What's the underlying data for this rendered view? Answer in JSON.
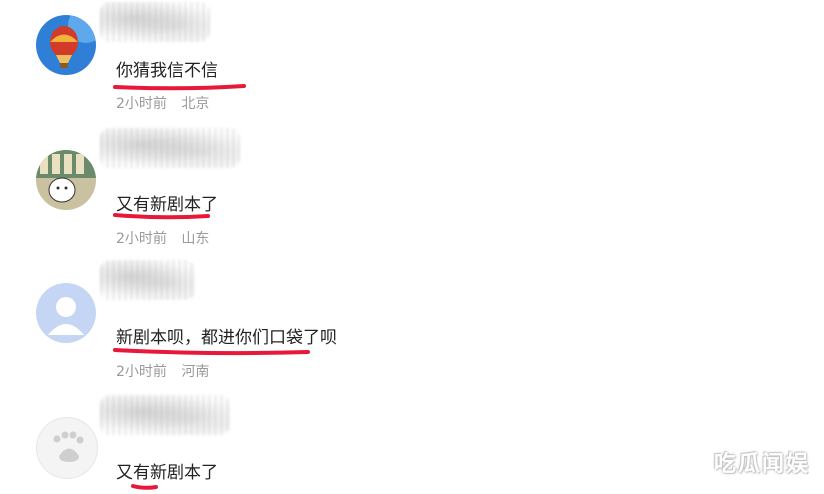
{
  "comments": [
    {
      "text": "你猜我信不信",
      "time": "2小时前",
      "location": "北京",
      "avatar": "hot-air-balloon-avatar"
    },
    {
      "text": "又有新剧本了",
      "time": "2小时前",
      "location": "山东",
      "avatar": "cartoon-animal-avatar"
    },
    {
      "text": "新剧本呗，都进你们口袋了呗",
      "time": "2小时前",
      "location": "河南",
      "avatar": "default-user-avatar"
    },
    {
      "text": "又有新剧本了",
      "time": "",
      "location": "",
      "avatar": "baidu-paw-avatar"
    }
  ],
  "watermark": "吃瓜闻娱",
  "colors": {
    "annotation": "#e8183a",
    "meta": "#9a9a9a",
    "text": "#222222"
  }
}
